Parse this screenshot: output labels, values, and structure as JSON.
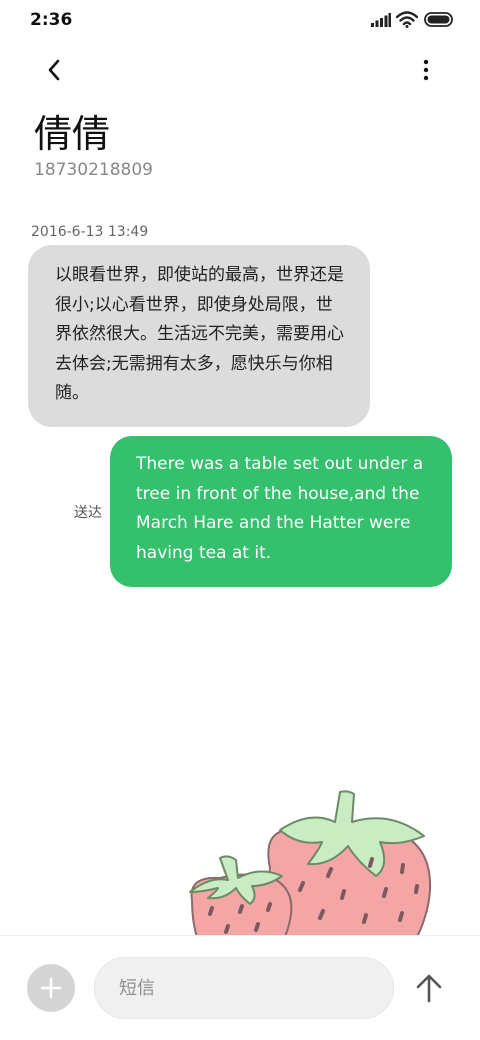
{
  "status_bar": {
    "time": "2:36",
    "icons": [
      "signal-icon",
      "wifi-icon",
      "battery-icon"
    ]
  },
  "header": {
    "back_icon": "chevron-left-icon",
    "more_icon": "more-vertical-icon",
    "contact_name": "倩倩",
    "contact_number": "18730218809"
  },
  "conversation": {
    "timestamp": "2016-6-13 13:49",
    "messages": [
      {
        "direction": "received",
        "text": "以眼看世界，即使站的最高，世界还是很小;以心看世界，即使身处局限，世界依然很大。生活远不完美，需要用心去体会;无需拥有太多，愿快乐与你相随。"
      },
      {
        "direction": "sent",
        "text": "There was a table set out under a tree in front of the house,and the March Hare and the Hatter were having tea at it.",
        "status": "送达"
      }
    ]
  },
  "composer": {
    "add_icon": "plus-icon",
    "placeholder": "短信",
    "value": "",
    "send_icon": "arrow-up-icon"
  },
  "colors": {
    "sent_bubble": "#34c06d",
    "received_bubble": "#dcdcdc",
    "background": "#ffffff"
  },
  "decoration": "strawberry-illustration"
}
